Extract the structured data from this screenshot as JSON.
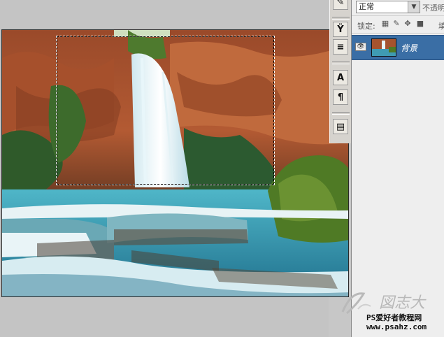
{
  "layers_panel": {
    "blend_mode": "正常",
    "opacity_label": "不透明",
    "lock_label": "锁定:",
    "fill_label": "填",
    "layers": [
      {
        "name": "背景",
        "visible": true,
        "selected": true
      }
    ]
  },
  "toolbar": {
    "tools": [
      "wand-icon",
      "brush-preset-icon",
      "tool-preset-icon",
      "character-icon",
      "paragraph-icon",
      "navigator-icon"
    ],
    "character_glyph": "A",
    "paragraph_glyph": "¶"
  },
  "watermark": {
    "site": "PS爱好者教程网",
    "url": "www.psahz.com"
  },
  "colors": {
    "selected_layer": "#3a6ea5",
    "panel_bg": "#eeeeee",
    "workspace_bg": "#c4c4c4"
  }
}
